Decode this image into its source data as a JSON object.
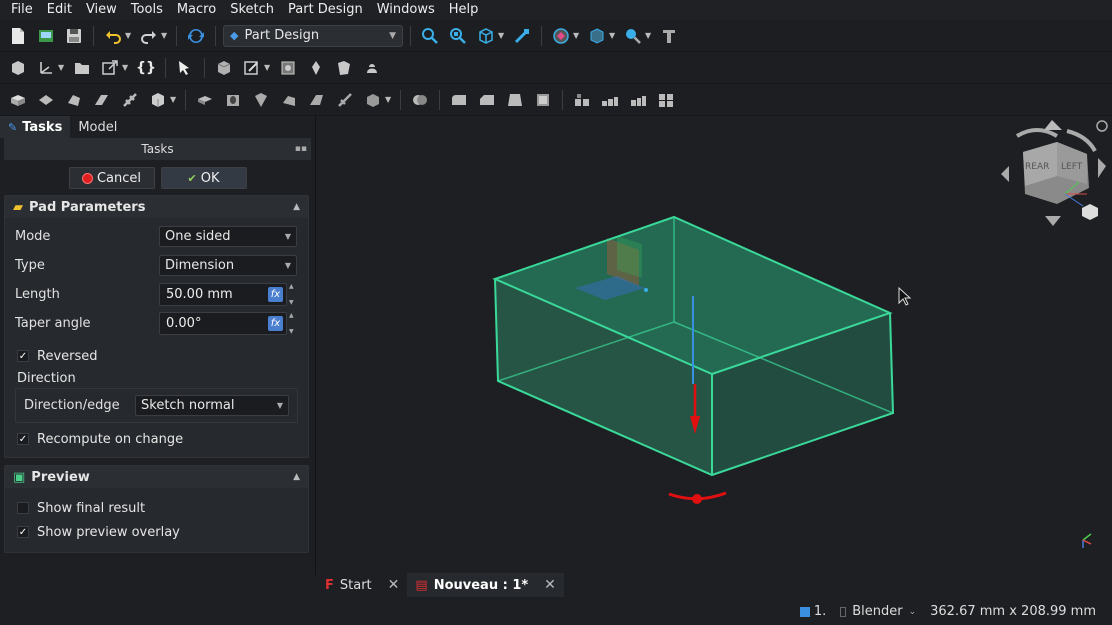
{
  "menu": [
    "File",
    "Edit",
    "View",
    "Tools",
    "Macro",
    "Sketch",
    "Part Design",
    "Windows",
    "Help"
  ],
  "workbench": "Part Design",
  "panel_tabs": {
    "tasks": "Tasks",
    "model": "Model"
  },
  "tasks_header": "Tasks",
  "buttons": {
    "cancel": "Cancel",
    "ok": "OK"
  },
  "pad": {
    "title": "Pad Parameters",
    "mode_label": "Mode",
    "mode_value": "One sided",
    "type_label": "Type",
    "type_value": "Dimension",
    "length_label": "Length",
    "length_value": "50.00 mm",
    "taper_label": "Taper angle",
    "taper_value": "0.00°",
    "reversed_label": "Reversed",
    "reversed_checked": true,
    "direction_label": "Direction",
    "direction_edge_label": "Direction/edge",
    "direction_edge_value": "Sketch normal",
    "recompute_label": "Recompute on change",
    "recompute_checked": true
  },
  "preview": {
    "title": "Preview",
    "final_label": "Show final result",
    "final_checked": false,
    "overlay_label": "Show preview overlay",
    "overlay_checked": true
  },
  "navcube": {
    "face_rear": "REAR",
    "face_left": "LEFT"
  },
  "doc_tabs": {
    "start": "Start",
    "doc": "Nouveau : 1*"
  },
  "status": {
    "selection": "1.",
    "nav_style": "Blender",
    "dimensions": "362.67 mm x 208.99 mm"
  },
  "colors": {
    "accent": "#3ad99a",
    "arrow": "#e01010",
    "axis": "#3b8fe0",
    "background": "#1d1f23"
  },
  "checkmark": "✓",
  "fx_glyph": "fx"
}
